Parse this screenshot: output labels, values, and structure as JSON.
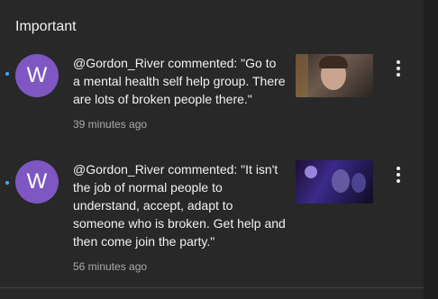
{
  "header": {
    "title": "Important"
  },
  "notifications": [
    {
      "avatar_letter": "W",
      "text": "@Gordon_River commented: \"Go to a mental health self help group. There are lots of broken people there.\"",
      "time": "39 minutes ago",
      "icon": "more-vert-icon"
    },
    {
      "avatar_letter": "W",
      "text": "@Gordon_River commented: \"It isn't the job of normal people to understand, accept, adapt to someone who is broken. Get help and then come join the party.\"",
      "time": "56 minutes ago",
      "icon": "more-vert-icon"
    }
  ],
  "colors": {
    "background": "#282828",
    "avatar": "#7e57c2",
    "unread_dot": "#3ea6ff",
    "primary_text": "#f1f1f1",
    "secondary_text": "#aaaaaa"
  }
}
